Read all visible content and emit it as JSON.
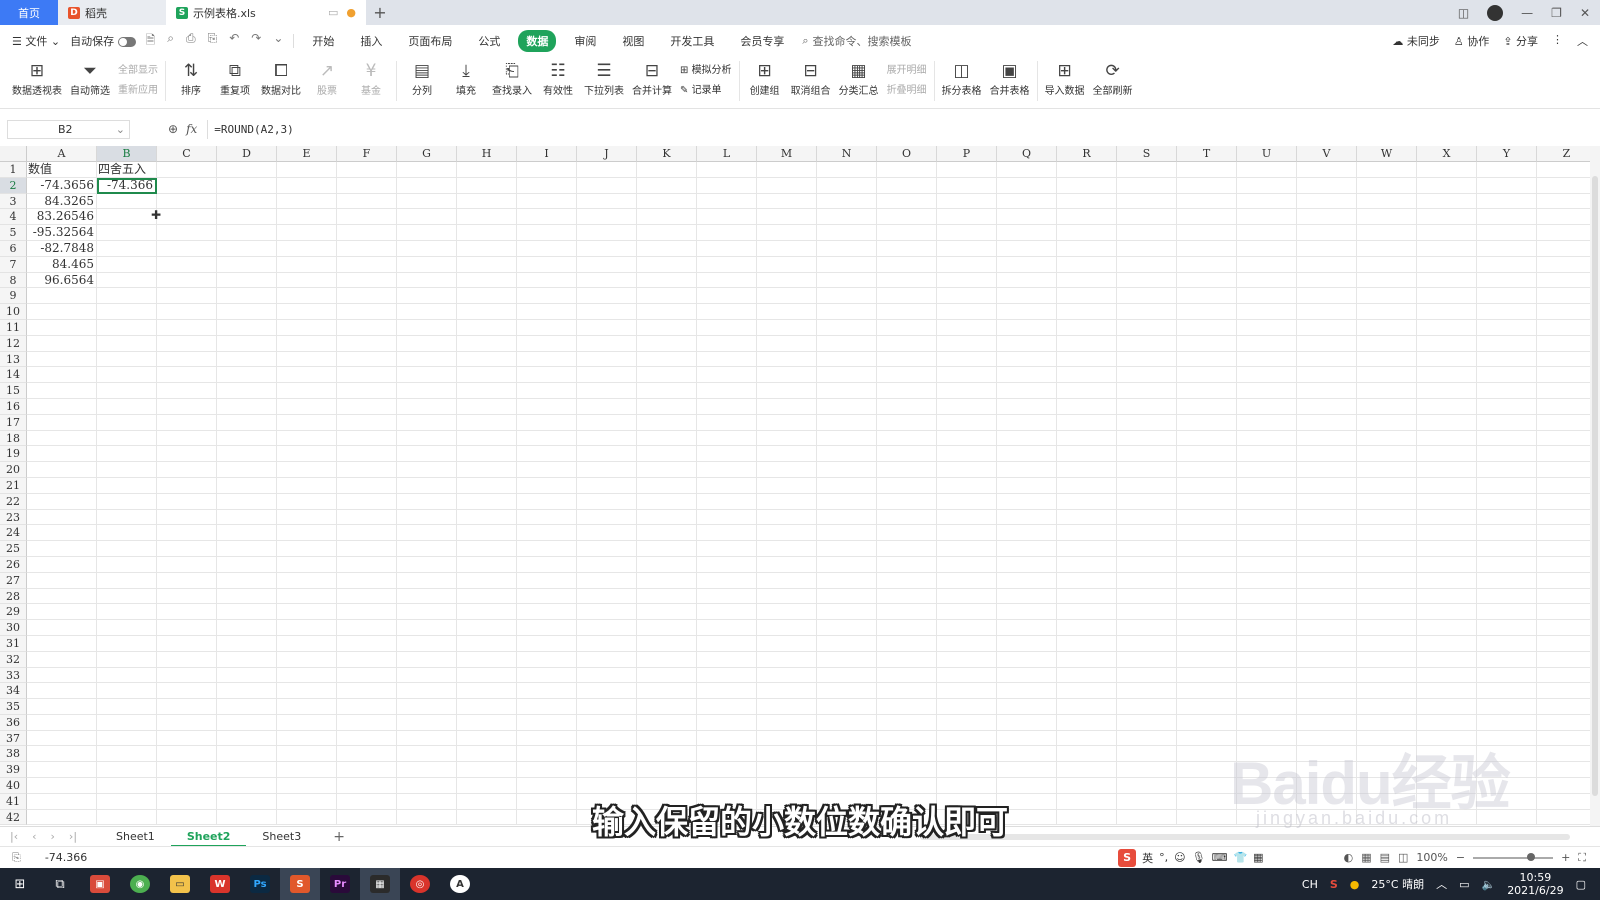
{
  "tabs": {
    "home": "首页",
    "daoke": "稻壳",
    "file": "示例表格.xls"
  },
  "menu": {
    "file": "文件",
    "autosave": "自动保存",
    "tabs": [
      "开始",
      "插入",
      "页面布局",
      "公式",
      "数据",
      "审阅",
      "视图",
      "开发工具",
      "会员专享"
    ],
    "active_tab": "数据",
    "search": "查找命令、搜索模板",
    "sync": "未同步",
    "collab": "协作",
    "share": "分享"
  },
  "ribbon": {
    "pivot": "数据透视表",
    "autofilter": "自动筛选",
    "showall": "全部显示",
    "reapply": "重新应用",
    "sort": "排序",
    "dup": "重复项",
    "compare": "数据对比",
    "stock": "股票",
    "fund": "基金",
    "split": "分列",
    "fill": "填充",
    "lookup": "查找录入",
    "validity": "有效性",
    "dropdown": "下拉列表",
    "consolidate": "合并计算",
    "whatif": "模拟分析",
    "record": "记录单",
    "group": "创建组",
    "ungroup": "取消组合",
    "subtotal": "分类汇总",
    "expand": "展开明细",
    "collapse": "折叠明细",
    "splittable": "拆分表格",
    "mergetable": "合并表格",
    "import": "导入数据",
    "refresh": "全部刷新"
  },
  "formula_bar": {
    "cell_ref": "B2",
    "formula": "=ROUND(A2,3)"
  },
  "columns": [
    "A",
    "B",
    "C",
    "D",
    "E",
    "F",
    "G",
    "H",
    "I",
    "J",
    "K",
    "L",
    "M",
    "N",
    "O",
    "P",
    "Q",
    "R",
    "S",
    "T",
    "U",
    "V",
    "W",
    "X",
    "Y",
    "Z"
  ],
  "cells": {
    "A1": "数值",
    "B1": "四舍五入",
    "A2": "-74.3656",
    "B2": "-74.366",
    "A3": "84.3265",
    "A4": "83.26546",
    "A5": "-95.32564",
    "A6": "-82.7848",
    "A7": "84.465",
    "A8": "96.6564"
  },
  "sheets": [
    "Sheet1",
    "Sheet2",
    "Sheet3"
  ],
  "active_sheet": "Sheet2",
  "status": {
    "value": "-74.366",
    "zoom": "100%"
  },
  "ime": {
    "lang": "英"
  },
  "subtitle": "输入保留的小数位数确认即可",
  "watermark": {
    "brand": "Baidu经验",
    "url": "jingyan.baidu.com"
  },
  "taskbar": {
    "weather": "25°C 晴朗",
    "time": "10:59",
    "date": "2021/6/29",
    "input": "CH"
  },
  "colors": {
    "accent_green": "#1fa35b",
    "home_blue": "#3d7af5"
  }
}
